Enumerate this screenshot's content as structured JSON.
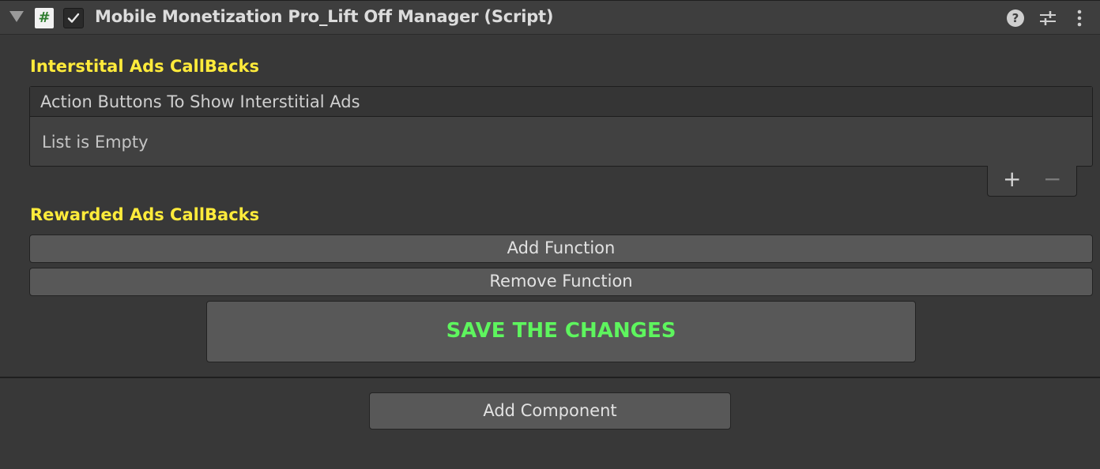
{
  "component": {
    "title": "Mobile Monetization Pro_Lift Off Manager (Script)",
    "enabled": true,
    "script_icon_glyph": "#",
    "help_glyph": "?",
    "icons": [
      "foldout-arrow-icon",
      "script-icon",
      "checkbox-icon",
      "help-icon",
      "presets-icon",
      "menu-icon"
    ]
  },
  "interstitial": {
    "section_label": "Interstital Ads CallBacks",
    "list_header": "Action Buttons To Show Interstitial Ads",
    "empty_text": "List is Empty",
    "add_glyph": "+",
    "remove_glyph": "−"
  },
  "rewarded": {
    "section_label": "Rewarded Ads CallBacks",
    "add_function_label": "Add Function",
    "remove_function_label": "Remove Function"
  },
  "save": {
    "label": "SAVE THE CHANGES"
  },
  "footer": {
    "add_component_label": "Add Component"
  },
  "colors": {
    "section_label": "#ffeb3b",
    "save_label": "#5ef55e",
    "background": "#383838",
    "button": "#585858"
  }
}
